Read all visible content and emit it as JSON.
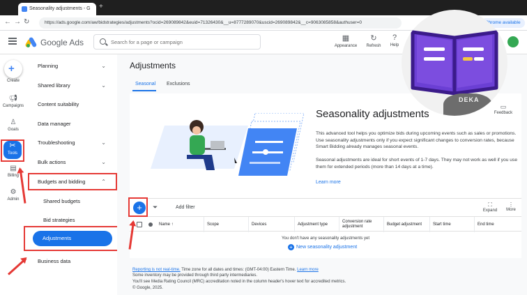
{
  "browser": {
    "tab_title": "Seasonality adjustments - G",
    "url": "https://ads.google.com/aw/bidstrategies/adjustments?ocid=269089842&euid=71326430&__u=8777289070&uscid=269089842&__c=9063085858&authuser=0",
    "chrome_pill": "Chrome available"
  },
  "header": {
    "brand": "Google Ads",
    "search_placeholder": "Search for a page or campaign",
    "tools": [
      {
        "label": "Appearance",
        "icon": "appearance-icon"
      },
      {
        "label": "Refresh",
        "icon": "refresh-icon"
      },
      {
        "label": "Help",
        "icon": "help-icon"
      }
    ]
  },
  "rail": {
    "create": "Create",
    "items": [
      {
        "label": "Campaigns",
        "icon": "megaphone-icon"
      },
      {
        "label": "Goals",
        "icon": "trophy-icon"
      },
      {
        "label": "Tools",
        "icon": "tools-icon"
      },
      {
        "label": "Billing",
        "icon": "billing-icon"
      },
      {
        "label": "Admin",
        "icon": "gear-icon"
      }
    ]
  },
  "sidenav": {
    "items": [
      {
        "label": "Planning",
        "chevron": "⌄"
      },
      {
        "label": "Shared library",
        "chevron": "⌄"
      },
      {
        "label": "Content suitability",
        "chevron": ""
      },
      {
        "label": "Data manager",
        "chevron": ""
      },
      {
        "label": "Troubleshooting",
        "chevron": "⌄"
      },
      {
        "label": "Bulk actions",
        "chevron": "⌄"
      },
      {
        "label": "Budgets and bidding",
        "chevron": "⌃"
      }
    ],
    "subitems": [
      "Shared budgets",
      "Bid strategies",
      "Adjustments"
    ],
    "last": "Business data"
  },
  "main": {
    "title": "Adjustments",
    "tabs": [
      "Seasonal",
      "Exclusions"
    ],
    "card": {
      "title": "Seasonality adjustments",
      "p1": "This advanced tool helps you optimize bids during upcoming events such as sales or promotions. Use seasonality adjustments only if you expect significant changes to conversion rates, because Smart Bidding already manages seasonal events.",
      "p2": "Seasonal adjustments are ideal for short events of 1-7 days. They may not work as well if you use them for extended periods (more than 14 days at a time).",
      "learn_more": "Learn more",
      "feedback": "Feedback"
    },
    "toolbar": {
      "add_filter": "Add filter",
      "expand": "Expand",
      "more": "More"
    },
    "table": {
      "columns": [
        "Name",
        "Scope",
        "Devices",
        "Adjustment type",
        "Conversion rate adjustment",
        "Budget adjustment",
        "Start time",
        "End time"
      ],
      "empty": "You don't have any seasonality adjustments yet",
      "new_link": "New seasonality adjustment"
    },
    "footer": {
      "line1_link": "Reporting is not real-time.",
      "line1_rest": " Time zone for all dates and times: (GMT-04:00) Eastern Time. ",
      "line1_learn": "Learn more",
      "line2": "Some inventory may be provided through third party intermediaries.",
      "line3": "You'll see Media Rating Council (MRC) accreditation noted in the column header's hover text for accredited metrics.",
      "line4": "© Google, 2025."
    }
  },
  "overlay": {
    "badge_text": "DEKA"
  },
  "colors": {
    "accent": "#1a73e8",
    "highlight": "#e53935",
    "book": "#6b3fd4"
  }
}
